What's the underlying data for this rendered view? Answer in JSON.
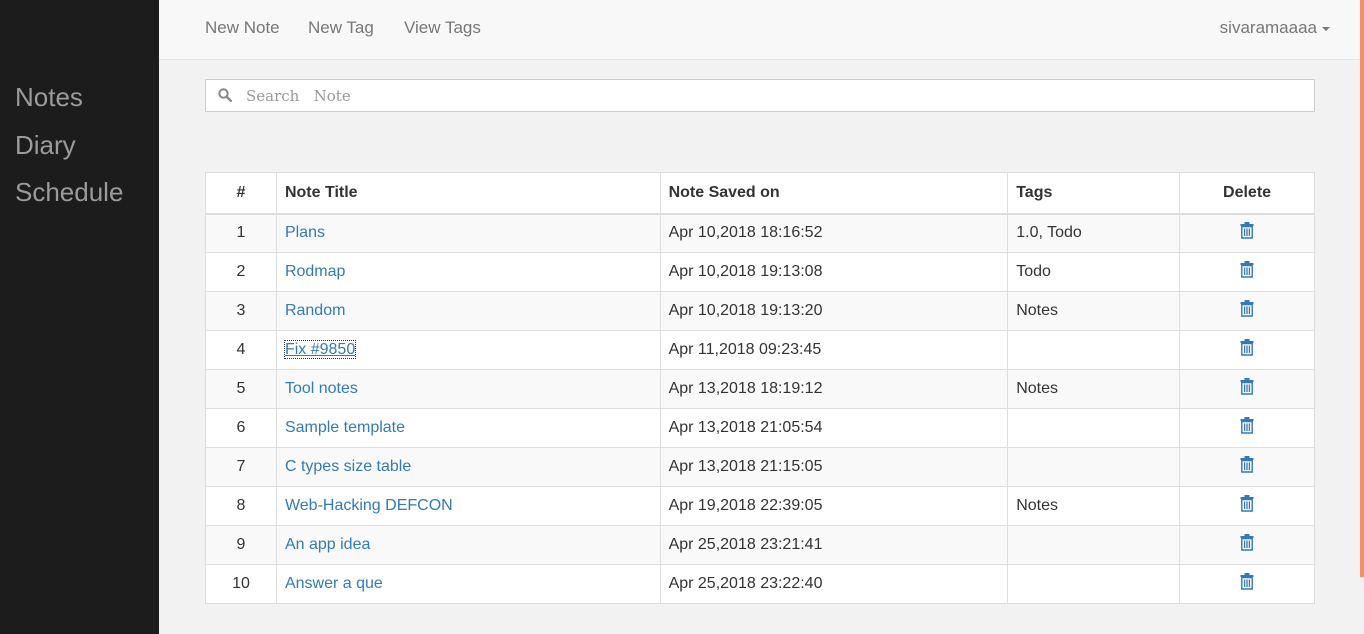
{
  "sidebar": {
    "items": [
      {
        "label": "Notes"
      },
      {
        "label": "Diary"
      },
      {
        "label": "Schedule"
      }
    ]
  },
  "navbar": {
    "new_note": "New Note",
    "new_tag": "New Tag",
    "view_tags": "View Tags",
    "user": "sivaramaaaa"
  },
  "search": {
    "placeholder": "Search   Note",
    "value": ""
  },
  "table": {
    "headers": {
      "index": "#",
      "title": "Note Title",
      "saved": "Note Saved on",
      "tags": "Tags",
      "delete": "Delete"
    },
    "rows": [
      {
        "index": "1",
        "title": "Plans",
        "saved": "Apr 10,2018 18:16:52",
        "tags": "1.0, Todo"
      },
      {
        "index": "2",
        "title": "Rodmap",
        "saved": "Apr 10,2018 19:13:08",
        "tags": "Todo"
      },
      {
        "index": "3",
        "title": "Random",
        "saved": "Apr 10,2018 19:13:20",
        "tags": "Notes"
      },
      {
        "index": "4",
        "title": "Fix #9850",
        "saved": "Apr 11,2018 09:23:45",
        "tags": ""
      },
      {
        "index": "5",
        "title": "Tool notes",
        "saved": "Apr 13,2018 18:19:12",
        "tags": "Notes"
      },
      {
        "index": "6",
        "title": "Sample template",
        "saved": "Apr 13,2018 21:05:54",
        "tags": ""
      },
      {
        "index": "7",
        "title": "C types size table",
        "saved": "Apr 13,2018 21:15:05",
        "tags": ""
      },
      {
        "index": "8",
        "title": "Web-Hacking DEFCON",
        "saved": "Apr 19,2018 22:39:05",
        "tags": "Notes"
      },
      {
        "index": "9",
        "title": "An app idea",
        "saved": "Apr 25,2018 23:21:41",
        "tags": ""
      },
      {
        "index": "10",
        "title": "Answer a que",
        "saved": "Apr 25,2018 23:22:40",
        "tags": ""
      }
    ]
  },
  "colors": {
    "sidebar_bg": "#1c1c1c",
    "link": "#337ab7",
    "accent": "#f2906c"
  },
  "icons": {
    "search": "search-icon",
    "delete": "trash-icon"
  }
}
